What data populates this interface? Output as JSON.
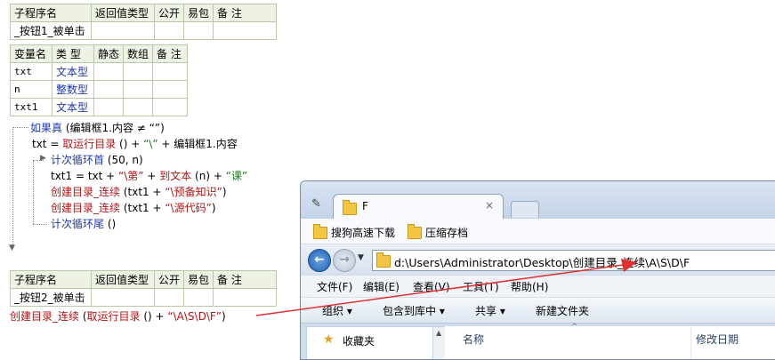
{
  "sub1": {
    "headers": [
      "子程序名",
      "返回值类型",
      "公开",
      "易包",
      "备 注"
    ],
    "name": "_按钮1_被单击"
  },
  "vars": {
    "headers": [
      "变量名",
      "类 型",
      "静态",
      "数组",
      "备 注"
    ],
    "rows": [
      {
        "name": "txt",
        "type": "文本型"
      },
      {
        "name": "n",
        "type": "整数型"
      },
      {
        "name": "txt1",
        "type": "文本型"
      }
    ]
  },
  "code": {
    "l1_kw": "如果真",
    "l1_rest": "(编辑框1.内容 ≠ “”)",
    "l2_a": "txt = ",
    "l2_fn": "取运行目录",
    "l2_b": " () + ",
    "l2_str": "“\\”",
    "l2_c": " + 编辑框1.内容",
    "l3_kw": "计次循环首",
    "l3_rest": " (50, n)",
    "l4_a": "txt1 = txt + ",
    "l4_s1": "“\\第”",
    "l4_b": " + ",
    "l4_fn": "到文本",
    "l4_c": " (n) + ",
    "l4_s2": "“课”",
    "l5_fn": "创建目录_连续",
    "l5_a": " (txt1 + ",
    "l5_str": "“\\预备知识”",
    "l5_b": ")",
    "l6_fn": "创建目录_连续",
    "l6_a": " (txt1 + ",
    "l6_str": "“\\源代码”",
    "l6_b": ")",
    "l7_kw": "计次循环尾",
    "l7_rest": " ()"
  },
  "sub2": {
    "headers": [
      "子程序名",
      "返回值类型",
      "公开",
      "易包",
      "备 注"
    ],
    "name": "_按钮2_被单击"
  },
  "code2": {
    "fn": "创建目录_连续",
    "a": " (",
    "fn2": "取运行目录",
    "b": " () + ",
    "str": "“\\A\\S\\D\\F”",
    "c": ")"
  },
  "explorer": {
    "tab_title": "F",
    "tab_close": "×",
    "bookmarks": [
      "搜狗高速下载",
      "压缩存档"
    ],
    "address": "d:\\Users\\Administrator\\Desktop\\创建目录_连续\\A\\S\\D\\F",
    "menu": [
      "文件(F)",
      "编辑(E)",
      "查看(V)",
      "工具(T)",
      "帮助(H)"
    ],
    "commands": [
      "组织 ▾",
      "包含到库中 ▾",
      "共享 ▾",
      "新建文件夹"
    ],
    "nav_first": "收藏夹",
    "col_name": "名称",
    "col_date": "修改日期",
    "sort_arrow": "^"
  },
  "colors": {
    "arrow": "#e23030",
    "code_green": "#1e7f1e",
    "code_blue": "#1f3aa8",
    "code_red": "#b01616"
  }
}
